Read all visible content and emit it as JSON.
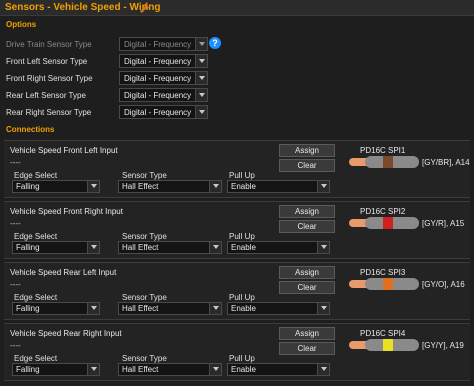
{
  "header": {
    "title": "Sensors - Vehicle Speed - Wiring"
  },
  "options": {
    "section_label": "Options",
    "rows": [
      {
        "label": "Drive Train Sensor Type",
        "value": "Digital - Frequency",
        "disabled": true,
        "help": "?"
      },
      {
        "label": "Front Left Sensor Type",
        "value": "Digital - Frequency",
        "disabled": false
      },
      {
        "label": "Front Right Sensor Type",
        "value": "Digital - Frequency",
        "disabled": false
      },
      {
        "label": "Rear Left Sensor Type",
        "value": "Digital - Frequency",
        "disabled": false
      },
      {
        "label": "Rear Right Sensor Type",
        "value": "Digital - Frequency",
        "disabled": false
      }
    ]
  },
  "connections": {
    "section_label": "Connections",
    "field_labels": {
      "edge": "Edge Select",
      "sensor": "Sensor Type",
      "pullup": "Pull Up"
    },
    "buttons": {
      "assign": "Assign",
      "clear": "Clear"
    },
    "items": [
      {
        "title": "Vehicle Speed Front Left Input",
        "assigned": "----",
        "edge": "Falling",
        "sensor": "Hall Effect",
        "pullup": "Enable",
        "pin_name": "PD16C SPI1",
        "pin_ref": "[GY/BR], A14",
        "wire_base": "#8a8a8a",
        "wire_stripe": "#7a4a2a"
      },
      {
        "title": "Vehicle Speed Front Right Input",
        "assigned": "----",
        "edge": "Falling",
        "sensor": "Hall Effect",
        "pullup": "Enable",
        "pin_name": "PD16C SPI2",
        "pin_ref": "[GY/R], A15",
        "wire_base": "#8a8a8a",
        "wire_stripe": "#d02020"
      },
      {
        "title": "Vehicle Speed Rear Left Input",
        "assigned": "----",
        "edge": "Falling",
        "sensor": "Hall Effect",
        "pullup": "Enable",
        "pin_name": "PD16C SPI3",
        "pin_ref": "[GY/O], A16",
        "wire_base": "#8a8a8a",
        "wire_stripe": "#e07020"
      },
      {
        "title": "Vehicle Speed Rear Right Input",
        "assigned": "----",
        "edge": "Falling",
        "sensor": "Hall Effect",
        "pullup": "Enable",
        "pin_name": "PD16C SPI4",
        "pin_ref": "[GY/Y], A19",
        "wire_base": "#8a8a8a",
        "wire_stripe": "#e8e020"
      }
    ]
  },
  "colors": {
    "accent": "#f0a000",
    "background": "#1e1e1e",
    "help": "#1e90ff",
    "wire_tip": "#e89a6a"
  }
}
